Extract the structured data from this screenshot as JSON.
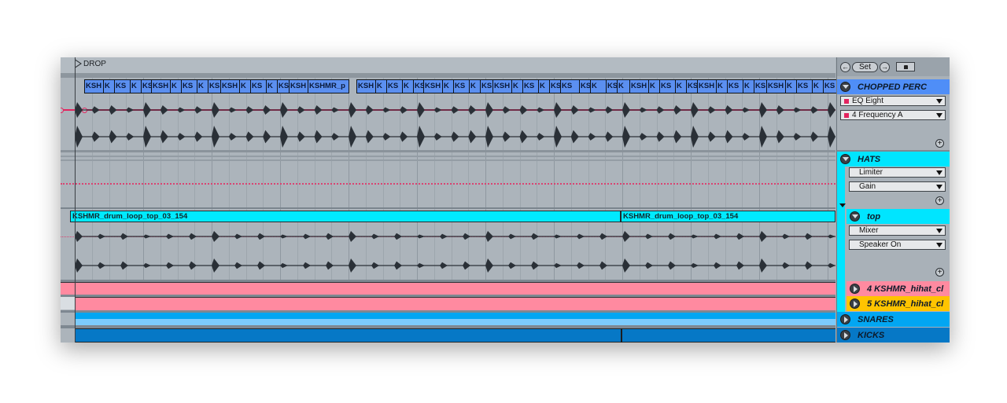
{
  "arrangement": {
    "locator_label": "DROP",
    "chopped_perc_clips": [
      [
        "KSH",
        "K",
        "KS",
        "K",
        "KS"
      ],
      [
        "KSH",
        "K",
        "KS",
        "K",
        "KS"
      ],
      [
        "KSH",
        "K",
        "KS",
        "K",
        "KS"
      ],
      [
        "KSH",
        "KSHMR_p"
      ],
      [
        "KSH",
        "K",
        "KS",
        "K",
        "KS"
      ],
      [
        "KSH",
        "K",
        "KS",
        "K",
        "KS"
      ],
      [
        "KSH",
        "K",
        "KS",
        "K",
        "KS"
      ],
      [
        "KS",
        "KSH",
        "K",
        "KS",
        "K"
      ],
      [
        "KSH",
        "K",
        "KS",
        "K",
        "KS"
      ],
      [
        "KSH",
        "K",
        "KS",
        "K",
        "KS"
      ],
      [
        "KSH",
        "K",
        "KS",
        "K",
        "KS"
      ]
    ],
    "top_clips": [
      "KSHMR_drum_loop_top_03_154",
      "KSHMR_drum_loop_top_03_154"
    ]
  },
  "panel": {
    "set_label": "Set",
    "tracks": [
      {
        "name": "CHOPPED PERC",
        "color": "#4f8ef7",
        "expanded": true,
        "devices": [
          {
            "label": "EQ Eight",
            "marker": true
          },
          {
            "label": "4 Frequency A",
            "marker": true
          }
        ]
      },
      {
        "name": "HATS",
        "color": "#00e5ff",
        "expanded": true,
        "devices": [
          {
            "label": "Limiter"
          },
          {
            "label": "Gain"
          }
        ]
      },
      {
        "name": "top",
        "color": "#00e5ff",
        "expanded": true,
        "devices": [
          {
            "label": "Mixer"
          },
          {
            "label": "Speaker On"
          }
        ]
      },
      {
        "name": "4 KSHMR_hihat_cl",
        "color": "#ff8aa0",
        "expanded": false
      },
      {
        "name": "5 KSHMR_hihat_cl",
        "color": "#ffc400",
        "expanded": false
      },
      {
        "name": "SNARES",
        "color": "#02a6f2",
        "expanded": false
      },
      {
        "name": "KICKS",
        "color": "#0678c6",
        "expanded": false
      }
    ]
  }
}
